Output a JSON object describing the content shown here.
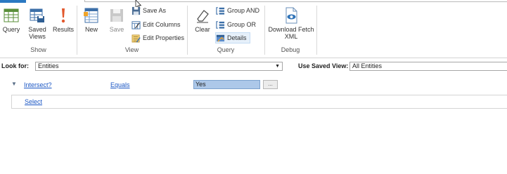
{
  "ribbon": {
    "groups": {
      "show": "Show",
      "view": "View",
      "query": "Query",
      "debug": "Debug"
    },
    "buttons": {
      "query": "Query",
      "saved_views": "Saved Views",
      "results": "Results",
      "new": "New",
      "save": "Save",
      "save_as": "Save As",
      "edit_columns": "Edit Columns",
      "edit_properties": "Edit Properties",
      "clear": "Clear",
      "group_and": "Group AND",
      "group_or": "Group OR",
      "details": "Details",
      "download_fetch_xml": "Download Fetch XML"
    }
  },
  "lookfor": {
    "label": "Look for:",
    "value": "Entities",
    "saved_view_label": "Use Saved View:",
    "saved_view_value": "All Entities"
  },
  "query": {
    "condition": {
      "field": "Intersect?",
      "operator": "Equals",
      "value": "Yes",
      "ellipsis": "..."
    },
    "select_link": "Select"
  },
  "colors": {
    "accent": "#2b79c2",
    "link": "#1a56c4",
    "value_highlight": "#adc8e9"
  }
}
